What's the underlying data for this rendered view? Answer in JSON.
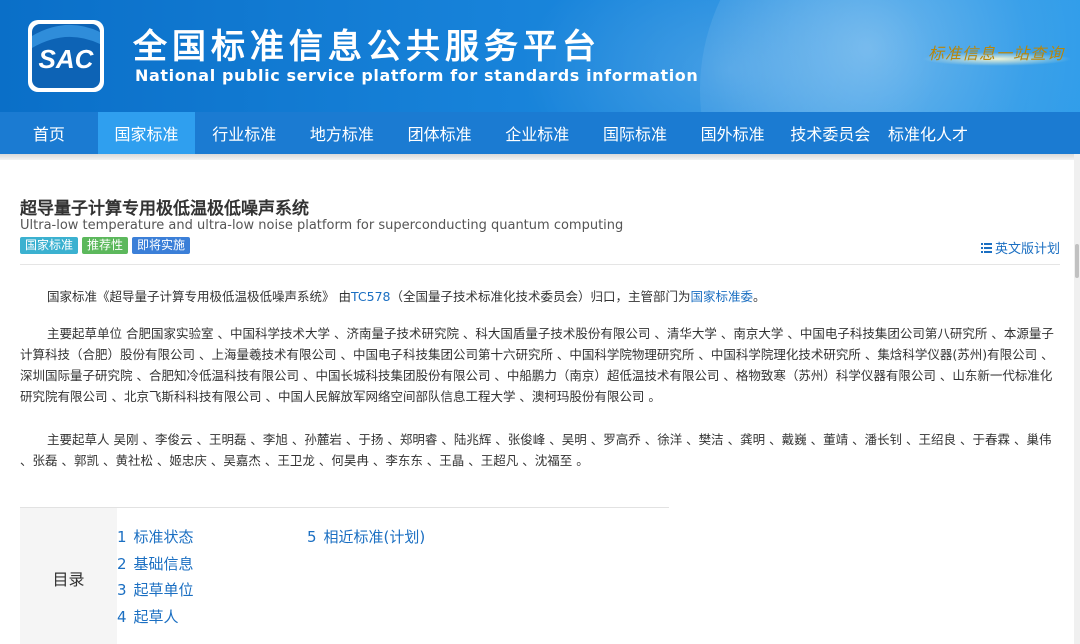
{
  "header": {
    "logo_text": "SAC",
    "title_cn": "全国标准信息公共服务平台",
    "title_en": "National public service platform  for standards information",
    "slogan": "标准信息一站查询"
  },
  "nav": {
    "items": [
      {
        "label": "首页",
        "active": false
      },
      {
        "label": "国家标准",
        "active": true
      },
      {
        "label": "行业标准",
        "active": false
      },
      {
        "label": "地方标准",
        "active": false
      },
      {
        "label": "团体标准",
        "active": false
      },
      {
        "label": "企业标准",
        "active": false
      },
      {
        "label": "国际标准",
        "active": false
      },
      {
        "label": "国外标准",
        "active": false
      },
      {
        "label": "技术委员会",
        "active": false
      },
      {
        "label": "标准化人才",
        "active": false
      }
    ]
  },
  "standard": {
    "title_cn": "超导量子计算专用极低温极低噪声系统",
    "title_en": "Ultra-low temperature and ultra-low noise platform for superconducting quantum computing",
    "badges": [
      {
        "label": "国家标准",
        "color": "#3bb1d0"
      },
      {
        "label": "推荐性",
        "color": "#5cb85c"
      },
      {
        "label": "即将实施",
        "color": "#3b7fd8"
      }
    ],
    "english_plan": "英文版计划"
  },
  "intro": {
    "prefix": "国家标准《超导量子计算专用极低温极低噪声系统》 由",
    "tc_link": "TC578",
    "middle": "（全国量子技术标准化技术委员会）归口，主管部门为",
    "dept_link": "国家标准委",
    "suffix": "。"
  },
  "drafting_units": {
    "label": "主要起草单位",
    "text": "合肥国家实验室 、中国科学技术大学 、济南量子技术研究院 、科大国盾量子技术股份有限公司 、清华大学 、南京大学 、中国电子科技集团公司第八研究所 、本源量子计算科技（合肥）股份有限公司 、上海量羲技术有限公司 、中国电子科技集团公司第十六研究所 、中国科学院物理研究所 、中国科学院理化技术研究所 、集焓科学仪器(苏州)有限公司 、深圳国际量子研究院 、合肥知冷低温科技有限公司 、中国长城科技集团股份有限公司 、中船鹏力（南京）超低温技术有限公司 、格物致寒（苏州）科学仪器有限公司 、山东新一代标准化研究院有限公司 、北京飞斯科科技有限公司 、中国人民解放军网络空间部队信息工程大学 、澳柯玛股份有限公司 。"
  },
  "drafters": {
    "label": "主要起草人",
    "text": "吴刚 、李俊云 、王明磊 、李旭 、孙麓岩 、于扬 、郑明睿 、陆兆辉 、张俊峰 、吴明 、罗高乔 、徐洋 、樊洁 、龚明 、戴巍 、董靖 、潘长钊 、王绍良 、于春霖 、巢伟 、张磊 、郭凯 、黄社松 、姬忠庆 、吴嘉杰 、王卫龙 、何昊冉 、李东东 、王晶 、王超凡 、沈福至 。"
  },
  "toc": {
    "label": "目录",
    "col1": [
      {
        "num": "1",
        "label": "标准状态"
      },
      {
        "num": "2",
        "label": "基础信息"
      },
      {
        "num": "3",
        "label": "起草单位"
      },
      {
        "num": "4",
        "label": "起草人"
      }
    ],
    "col2": [
      {
        "num": "5",
        "label": "相近标准(计划)"
      }
    ]
  }
}
